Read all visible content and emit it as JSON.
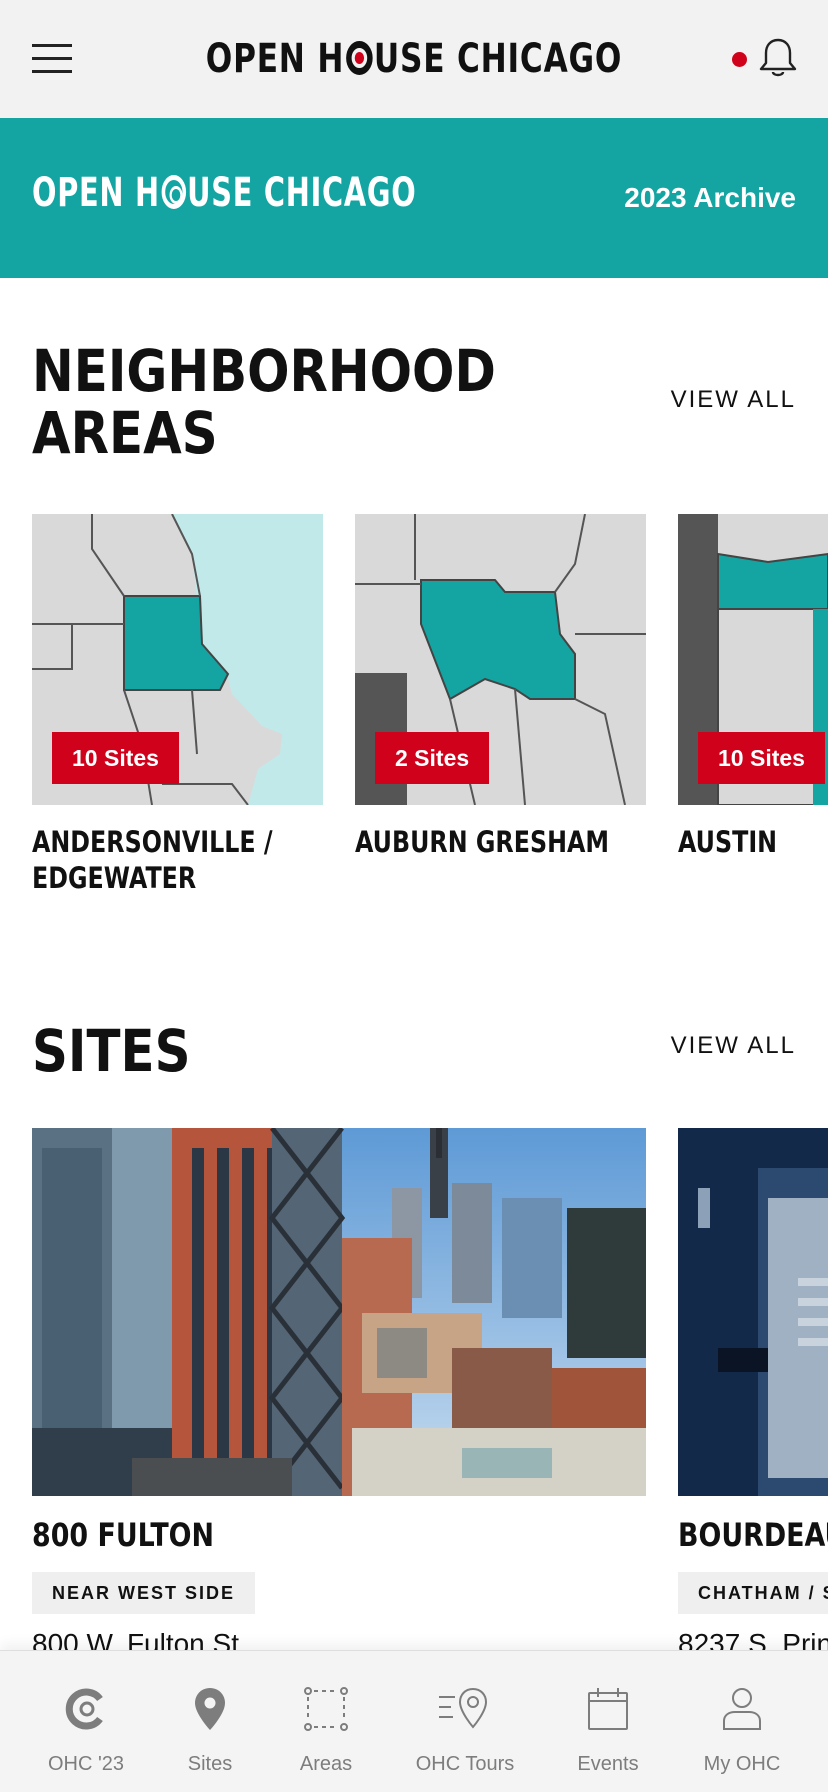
{
  "header": {
    "logo_text_left": "OPEN H",
    "logo_text_right": "USE CHICAGO",
    "menu_icon": "hamburger-icon",
    "bell_icon": "bell-icon",
    "notification_dot_color": "#d0021b"
  },
  "banner": {
    "logo_text_left": "OPEN H",
    "logo_text_right": "USE CHICAGO",
    "archive_label": "2023 Archive",
    "background_color": "#14a5a3"
  },
  "neighborhoods": {
    "title_line1": "NEIGHBORHOOD",
    "title_line2": "AREAS",
    "view_all": "VIEW ALL",
    "items": [
      {
        "badge": "10 Sites",
        "name_line1": "ANDERSONVILLE /",
        "name_line2": "EDGEWATER"
      },
      {
        "badge": "2 Sites",
        "name_line1": "AUBURN GRESHAM",
        "name_line2": ""
      },
      {
        "badge": "10 Sites",
        "name_line1": "AUSTIN",
        "name_line2": ""
      }
    ]
  },
  "sites": {
    "title": "SITES",
    "view_all": "VIEW ALL",
    "items": [
      {
        "name": "800 FULTON",
        "tag": "NEAR WEST SIDE",
        "address": "800 W. Fulton St"
      },
      {
        "name": "BOURDEAU",
        "tag": "CHATHAM / S",
        "address": "8237 S. Prin"
      }
    ]
  },
  "tabbar": {
    "items": [
      {
        "label": "OHC '23",
        "icon": "ohc-logo-icon"
      },
      {
        "label": "Sites",
        "icon": "map-pin-icon"
      },
      {
        "label": "Areas",
        "icon": "area-select-icon"
      },
      {
        "label": "OHC Tours",
        "icon": "tour-route-icon"
      },
      {
        "label": "Events",
        "icon": "calendar-icon"
      },
      {
        "label": "My OHC",
        "icon": "user-icon"
      }
    ]
  },
  "colors": {
    "accent_red": "#d0021b",
    "teal": "#14a5a3",
    "tab_label": "#7d7d7d"
  }
}
